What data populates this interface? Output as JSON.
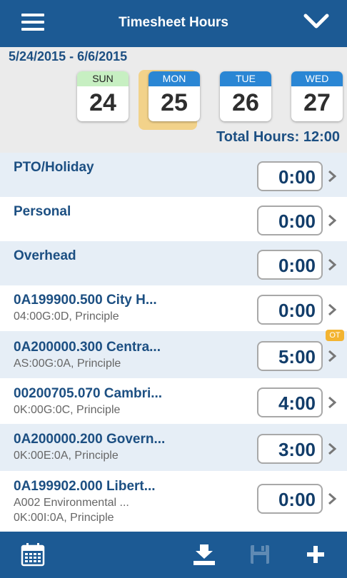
{
  "header": {
    "title": "Timesheet Hours",
    "menu_icon": "hamburger-icon",
    "expand_icon": "chevron-down-icon"
  },
  "week": {
    "range": "5/24/2015 - 6/6/2015",
    "days": [
      {
        "name": "SUN",
        "num": "24"
      },
      {
        "name": "MON",
        "num": "25"
      },
      {
        "name": "TUE",
        "num": "26"
      },
      {
        "name": "WED",
        "num": "27"
      }
    ],
    "selected_day": "MON",
    "total_label": "Total Hours: 12:00"
  },
  "rows": [
    {
      "name": "PTO/Holiday",
      "hours": "0:00"
    },
    {
      "name": "Personal",
      "hours": "0:00"
    },
    {
      "name": "Overhead",
      "hours": "0:00"
    },
    {
      "name": "0A199900.500 City H...",
      "sub1": "04:00G:0D, Principle",
      "hours": "0:00"
    },
    {
      "name": "0A200000.300 Centra...",
      "sub1": "AS:00G:0A, Principle",
      "hours": "5:00",
      "badge": "OT"
    },
    {
      "name": "00200705.070 Cambri...",
      "sub1": "0K:00G:0C, Principle",
      "hours": "4:00"
    },
    {
      "name": "0A200000.200 Govern...",
      "sub1": "0K:00E:0A, Principle",
      "hours": "3:00"
    },
    {
      "name": "0A199902.000 Libert...",
      "sub1": "A002 Environmental ...",
      "sub2": "0K:00I:0A, Principle",
      "hours": "0:00"
    }
  ],
  "footer": {
    "icons": [
      "calendar-icon",
      "download-icon",
      "save-icon",
      "add-icon"
    ]
  },
  "colors": {
    "primary": "#1c5a94",
    "text_blue": "#1c4f82",
    "selected_day_bg": "#f2d28a",
    "ot_badge": "#f3b431",
    "row_alt": "#e6eef6"
  }
}
